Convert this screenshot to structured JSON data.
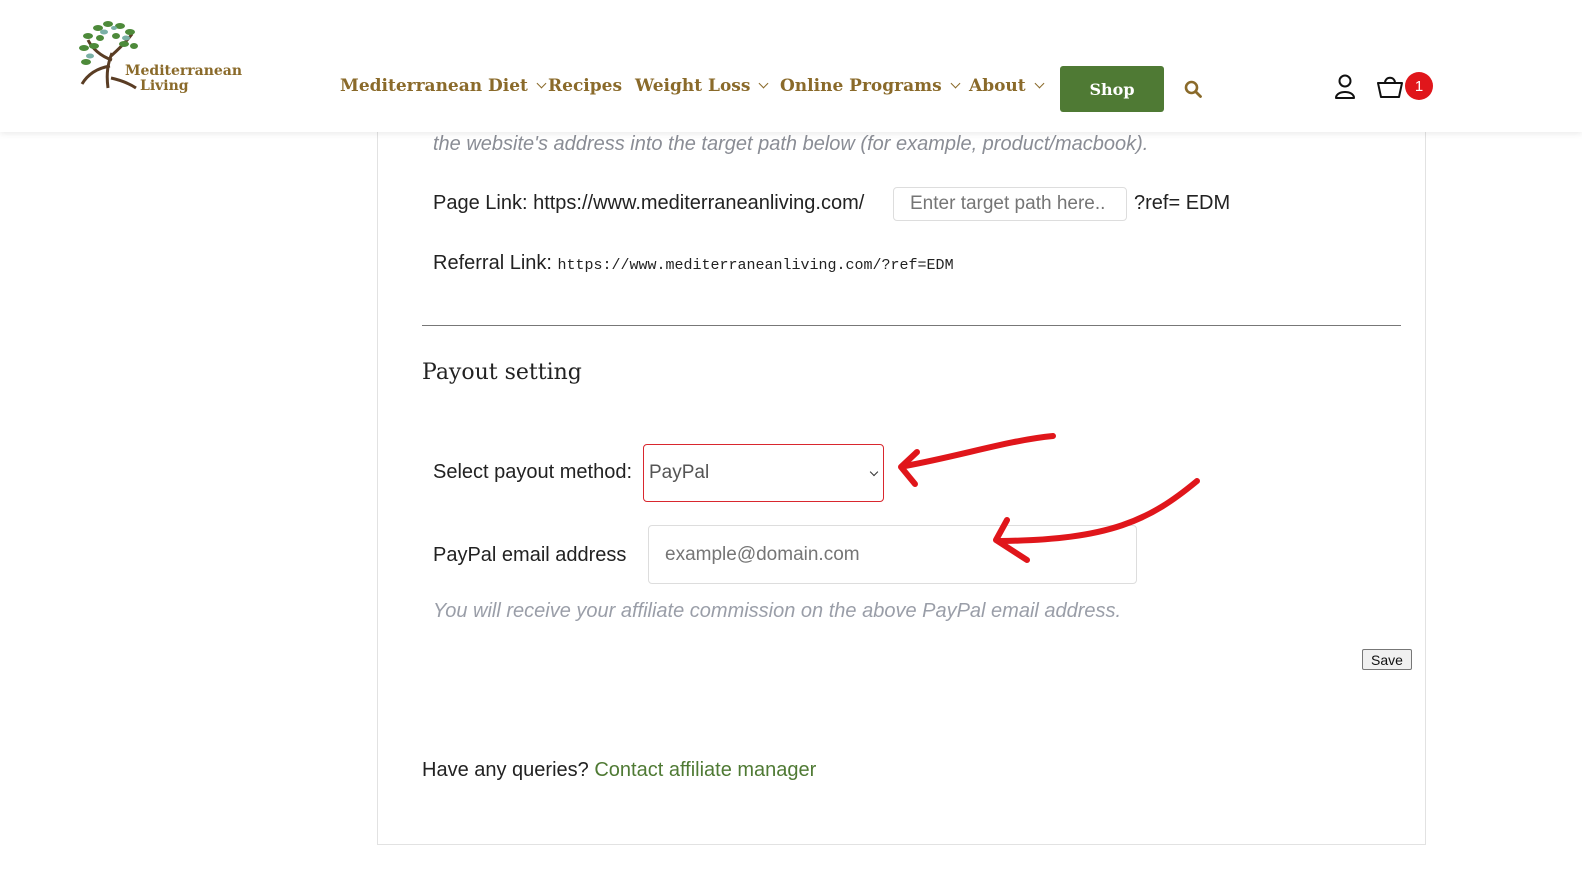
{
  "header": {
    "logo_line1": "Mediterranean",
    "logo_line2": "Living",
    "nav": [
      {
        "label": "Mediterranean Diet",
        "dropdown": true
      },
      {
        "label": "Recipes",
        "dropdown": false
      },
      {
        "label": "Weight Loss",
        "dropdown": true
      },
      {
        "label": "Online Programs",
        "dropdown": true
      },
      {
        "label": "About",
        "dropdown": true
      }
    ],
    "shop_label": "Shop",
    "cart_count": "1",
    "icons": [
      "search-icon",
      "user-icon",
      "cart-icon"
    ]
  },
  "referral": {
    "intro_text": "the website's address into the target path below (for example, product/macbook).",
    "page_link_label": "Page Link: https://www.mediterraneanliving.com/",
    "target_path_placeholder": "Enter target path here..",
    "ref_suffix": "?ref= EDM",
    "referral_link_label": "Referral Link:",
    "referral_link_value": "https://www.mediterraneanliving.com/?ref=EDM"
  },
  "payout": {
    "title": "Payout setting",
    "method_label": "Select payout method:",
    "method_value": "PayPal",
    "email_label": "PayPal email address",
    "email_placeholder": "example@domain.com",
    "note": "You will receive your affiliate commission on the above PayPal email address.",
    "save_label": "Save"
  },
  "footer": {
    "queries_text": "Have any queries?",
    "contact_link": "Contact affiliate manager"
  },
  "colors": {
    "brand_brown": "#8a6a2a",
    "brand_green": "#4f7a34",
    "badge_red": "#e0161b",
    "annotation_red": "#e0161b"
  }
}
